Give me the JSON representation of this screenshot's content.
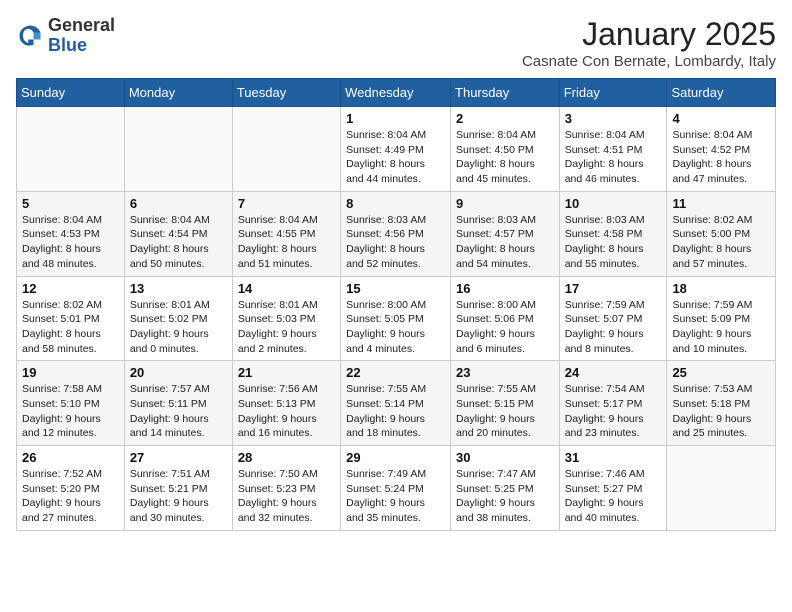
{
  "logo": {
    "general": "General",
    "blue": "Blue"
  },
  "title": "January 2025",
  "subtitle": "Casnate Con Bernate, Lombardy, Italy",
  "headers": [
    "Sunday",
    "Monday",
    "Tuesday",
    "Wednesday",
    "Thursday",
    "Friday",
    "Saturday"
  ],
  "weeks": [
    [
      {
        "day": "",
        "info": ""
      },
      {
        "day": "",
        "info": ""
      },
      {
        "day": "",
        "info": ""
      },
      {
        "day": "1",
        "info": "Sunrise: 8:04 AM\nSunset: 4:49 PM\nDaylight: 8 hours\nand 44 minutes."
      },
      {
        "day": "2",
        "info": "Sunrise: 8:04 AM\nSunset: 4:50 PM\nDaylight: 8 hours\nand 45 minutes."
      },
      {
        "day": "3",
        "info": "Sunrise: 8:04 AM\nSunset: 4:51 PM\nDaylight: 8 hours\nand 46 minutes."
      },
      {
        "day": "4",
        "info": "Sunrise: 8:04 AM\nSunset: 4:52 PM\nDaylight: 8 hours\nand 47 minutes."
      }
    ],
    [
      {
        "day": "5",
        "info": "Sunrise: 8:04 AM\nSunset: 4:53 PM\nDaylight: 8 hours\nand 48 minutes."
      },
      {
        "day": "6",
        "info": "Sunrise: 8:04 AM\nSunset: 4:54 PM\nDaylight: 8 hours\nand 50 minutes."
      },
      {
        "day": "7",
        "info": "Sunrise: 8:04 AM\nSunset: 4:55 PM\nDaylight: 8 hours\nand 51 minutes."
      },
      {
        "day": "8",
        "info": "Sunrise: 8:03 AM\nSunset: 4:56 PM\nDaylight: 8 hours\nand 52 minutes."
      },
      {
        "day": "9",
        "info": "Sunrise: 8:03 AM\nSunset: 4:57 PM\nDaylight: 8 hours\nand 54 minutes."
      },
      {
        "day": "10",
        "info": "Sunrise: 8:03 AM\nSunset: 4:58 PM\nDaylight: 8 hours\nand 55 minutes."
      },
      {
        "day": "11",
        "info": "Sunrise: 8:02 AM\nSunset: 5:00 PM\nDaylight: 8 hours\nand 57 minutes."
      }
    ],
    [
      {
        "day": "12",
        "info": "Sunrise: 8:02 AM\nSunset: 5:01 PM\nDaylight: 8 hours\nand 58 minutes."
      },
      {
        "day": "13",
        "info": "Sunrise: 8:01 AM\nSunset: 5:02 PM\nDaylight: 9 hours\nand 0 minutes."
      },
      {
        "day": "14",
        "info": "Sunrise: 8:01 AM\nSunset: 5:03 PM\nDaylight: 9 hours\nand 2 minutes."
      },
      {
        "day": "15",
        "info": "Sunrise: 8:00 AM\nSunset: 5:05 PM\nDaylight: 9 hours\nand 4 minutes."
      },
      {
        "day": "16",
        "info": "Sunrise: 8:00 AM\nSunset: 5:06 PM\nDaylight: 9 hours\nand 6 minutes."
      },
      {
        "day": "17",
        "info": "Sunrise: 7:59 AM\nSunset: 5:07 PM\nDaylight: 9 hours\nand 8 minutes."
      },
      {
        "day": "18",
        "info": "Sunrise: 7:59 AM\nSunset: 5:09 PM\nDaylight: 9 hours\nand 10 minutes."
      }
    ],
    [
      {
        "day": "19",
        "info": "Sunrise: 7:58 AM\nSunset: 5:10 PM\nDaylight: 9 hours\nand 12 minutes."
      },
      {
        "day": "20",
        "info": "Sunrise: 7:57 AM\nSunset: 5:11 PM\nDaylight: 9 hours\nand 14 minutes."
      },
      {
        "day": "21",
        "info": "Sunrise: 7:56 AM\nSunset: 5:13 PM\nDaylight: 9 hours\nand 16 minutes."
      },
      {
        "day": "22",
        "info": "Sunrise: 7:55 AM\nSunset: 5:14 PM\nDaylight: 9 hours\nand 18 minutes."
      },
      {
        "day": "23",
        "info": "Sunrise: 7:55 AM\nSunset: 5:15 PM\nDaylight: 9 hours\nand 20 minutes."
      },
      {
        "day": "24",
        "info": "Sunrise: 7:54 AM\nSunset: 5:17 PM\nDaylight: 9 hours\nand 23 minutes."
      },
      {
        "day": "25",
        "info": "Sunrise: 7:53 AM\nSunset: 5:18 PM\nDaylight: 9 hours\nand 25 minutes."
      }
    ],
    [
      {
        "day": "26",
        "info": "Sunrise: 7:52 AM\nSunset: 5:20 PM\nDaylight: 9 hours\nand 27 minutes."
      },
      {
        "day": "27",
        "info": "Sunrise: 7:51 AM\nSunset: 5:21 PM\nDaylight: 9 hours\nand 30 minutes."
      },
      {
        "day": "28",
        "info": "Sunrise: 7:50 AM\nSunset: 5:23 PM\nDaylight: 9 hours\nand 32 minutes."
      },
      {
        "day": "29",
        "info": "Sunrise: 7:49 AM\nSunset: 5:24 PM\nDaylight: 9 hours\nand 35 minutes."
      },
      {
        "day": "30",
        "info": "Sunrise: 7:47 AM\nSunset: 5:25 PM\nDaylight: 9 hours\nand 38 minutes."
      },
      {
        "day": "31",
        "info": "Sunrise: 7:46 AM\nSunset: 5:27 PM\nDaylight: 9 hours\nand 40 minutes."
      },
      {
        "day": "",
        "info": ""
      }
    ]
  ]
}
